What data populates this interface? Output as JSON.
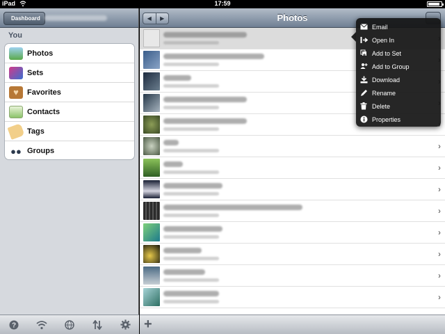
{
  "status_bar": {
    "carrier": "iPad",
    "time": "17:59"
  },
  "left_pane": {
    "back_label": "Dashboard",
    "section_label": "You",
    "items": [
      {
        "label": "Photos",
        "icon": "photos-icon"
      },
      {
        "label": "Sets",
        "icon": "sets-icon"
      },
      {
        "label": "Favorites",
        "icon": "favorites-icon"
      },
      {
        "label": "Contacts",
        "icon": "contacts-icon"
      },
      {
        "label": "Tags",
        "icon": "tags-icon"
      },
      {
        "label": "Groups",
        "icon": "groups-icon"
      }
    ],
    "toolbar_icons": [
      "help-icon",
      "wifi-icon",
      "globe-icon",
      "sort-icon",
      "gear-icon"
    ]
  },
  "right_pane": {
    "title": "Photos",
    "segment_icons": [
      "prev-arrow-icon",
      "next-arrow-icon"
    ],
    "rows": [
      {
        "thumb_color": "#e8e8e8"
      },
      {
        "thumb_color": "#3a5d8a"
      },
      {
        "thumb_color": "#1d2b3f"
      },
      {
        "thumb_color": "#263849"
      },
      {
        "thumb_color": "#50623b"
      },
      {
        "thumb_color": "#6d7a64"
      },
      {
        "thumb_color": "#5c8a3e"
      },
      {
        "thumb_color": "#1a2035"
      },
      {
        "thumb_color": "#2b2b2b"
      },
      {
        "thumb_color": "#3f9b56"
      },
      {
        "thumb_color": "#c8a640"
      },
      {
        "thumb_color": "#4b6a84"
      },
      {
        "thumb_color": "#3b8e96"
      }
    ]
  },
  "popover": {
    "items": [
      {
        "label": "Email",
        "icon": "mail-icon"
      },
      {
        "label": "Open In",
        "icon": "open-in-icon"
      },
      {
        "label": "Add to Set",
        "icon": "add-to-set-icon"
      },
      {
        "label": "Add to Group",
        "icon": "add-to-group-icon"
      },
      {
        "label": "Download",
        "icon": "download-icon"
      },
      {
        "label": "Rename",
        "icon": "rename-icon"
      },
      {
        "label": "Delete",
        "icon": "trash-icon"
      },
      {
        "label": "Properties",
        "icon": "info-icon"
      }
    ]
  }
}
